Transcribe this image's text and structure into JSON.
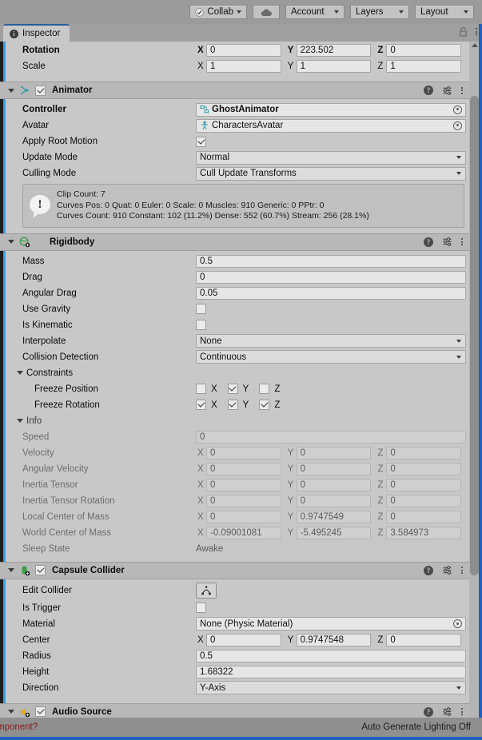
{
  "toolbar": {
    "collab": {
      "label": "Collab",
      "icon": "check-circle-icon"
    },
    "cloud": {
      "icon": "cloud-icon"
    },
    "account": {
      "label": "Account"
    },
    "layers": {
      "label": "Layers"
    },
    "layout": {
      "label": "Layout"
    }
  },
  "tab": {
    "label": "Inspector",
    "icon": "info-icon",
    "lock_icon": "lock-icon",
    "menu_icon": "kebab-menu-icon"
  },
  "transform": {
    "rotation": {
      "label": "Rotation",
      "x": "0",
      "y": "223.502",
      "z": "0"
    },
    "scale": {
      "label": "Scale",
      "x": "1",
      "y": "1",
      "z": "1"
    },
    "axis_x": "X",
    "axis_y": "Y",
    "axis_z": "Z"
  },
  "animator": {
    "title": "Animator",
    "enabled": true,
    "icon": "animator-icon",
    "controller": {
      "label": "Controller",
      "value": "GhostAnimator",
      "icon": "animator-controller-icon"
    },
    "avatar": {
      "label": "Avatar",
      "value": "CharactersAvatar",
      "icon": "avatar-icon"
    },
    "apply_root_motion": {
      "label": "Apply Root Motion",
      "checked": true
    },
    "update_mode": {
      "label": "Update Mode",
      "value": "Normal"
    },
    "culling_mode": {
      "label": "Culling Mode",
      "value": "Cull Update Transforms"
    },
    "info_box": {
      "icon": "warning-icon",
      "line1": "Clip Count: 7",
      "line2": "Curves Pos: 0 Quat: 0 Euler: 0 Scale: 0 Muscles: 910 Generic: 0 PPtr: 0",
      "line3": "Curves Count: 910 Constant: 102 (11.2%) Dense: 552 (60.7%) Stream: 256 (28.1%)"
    }
  },
  "rigidbody": {
    "title": "Rigidbody",
    "icon": "rigidbody-icon",
    "mass": {
      "label": "Mass",
      "value": "0.5"
    },
    "drag": {
      "label": "Drag",
      "value": "0"
    },
    "angular_drag": {
      "label": "Angular Drag",
      "value": "0.05"
    },
    "use_gravity": {
      "label": "Use Gravity",
      "checked": false
    },
    "is_kinematic": {
      "label": "Is Kinematic",
      "checked": false
    },
    "interpolate": {
      "label": "Interpolate",
      "value": "None"
    },
    "collision_detection": {
      "label": "Collision Detection",
      "value": "Continuous"
    },
    "constraints": {
      "label": "Constraints",
      "freeze_position": {
        "label": "Freeze Position",
        "x": false,
        "y": true,
        "z": false
      },
      "freeze_rotation": {
        "label": "Freeze Rotation",
        "x": true,
        "y": true,
        "z": true
      }
    },
    "info": {
      "label": "Info",
      "speed": {
        "label": "Speed",
        "value": "0"
      },
      "velocity": {
        "label": "Velocity",
        "x": "0",
        "y": "0",
        "z": "0"
      },
      "angular_velocity": {
        "label": "Angular Velocity",
        "x": "0",
        "y": "0",
        "z": "0"
      },
      "inertia_tensor": {
        "label": "Inertia Tensor",
        "x": "0",
        "y": "0",
        "z": "0"
      },
      "inertia_tensor_rotation": {
        "label": "Inertia Tensor Rotation",
        "x": "0",
        "y": "0",
        "z": "0"
      },
      "local_center_of_mass": {
        "label": "Local Center of Mass",
        "x": "0",
        "y": "0.9747549",
        "z": "0"
      },
      "world_center_of_mass": {
        "label": "World Center of Mass",
        "x": "-0.09001081",
        "y": "-5.495245",
        "z": "3.584973"
      },
      "sleep_state": {
        "label": "Sleep State",
        "value": "Awake"
      }
    }
  },
  "capsule_collider": {
    "title": "Capsule Collider",
    "enabled": true,
    "icon": "capsule-collider-icon",
    "edit_collider": {
      "label": "Edit Collider",
      "icon": "edit-collider-icon"
    },
    "is_trigger": {
      "label": "Is Trigger",
      "checked": false
    },
    "material": {
      "label": "Material",
      "value": "None (Physic Material)"
    },
    "center": {
      "label": "Center",
      "x": "0",
      "y": "0.9747548",
      "z": "0"
    },
    "radius": {
      "label": "Radius",
      "value": "0.5"
    },
    "height": {
      "label": "Height",
      "value": "1.68322"
    },
    "direction": {
      "label": "Direction",
      "value": "Y-Axis"
    }
  },
  "audio_source": {
    "title": "Audio Source",
    "enabled": true,
    "icon": "audio-source-icon"
  },
  "statusbar": {
    "left_text": "mponent?",
    "right_text": "Auto Generate Lighting Off"
  },
  "colors": {
    "accent_blue": "#1f5fbf",
    "prefab_blue": "#35a0e8",
    "panel": "#c8c8c8",
    "header": "#b8b8b8",
    "error_red": "#8b1a1a",
    "green_icon": "#3f9f4a",
    "orange_icon": "#e8a317",
    "teal_icon": "#3d9aa8"
  }
}
